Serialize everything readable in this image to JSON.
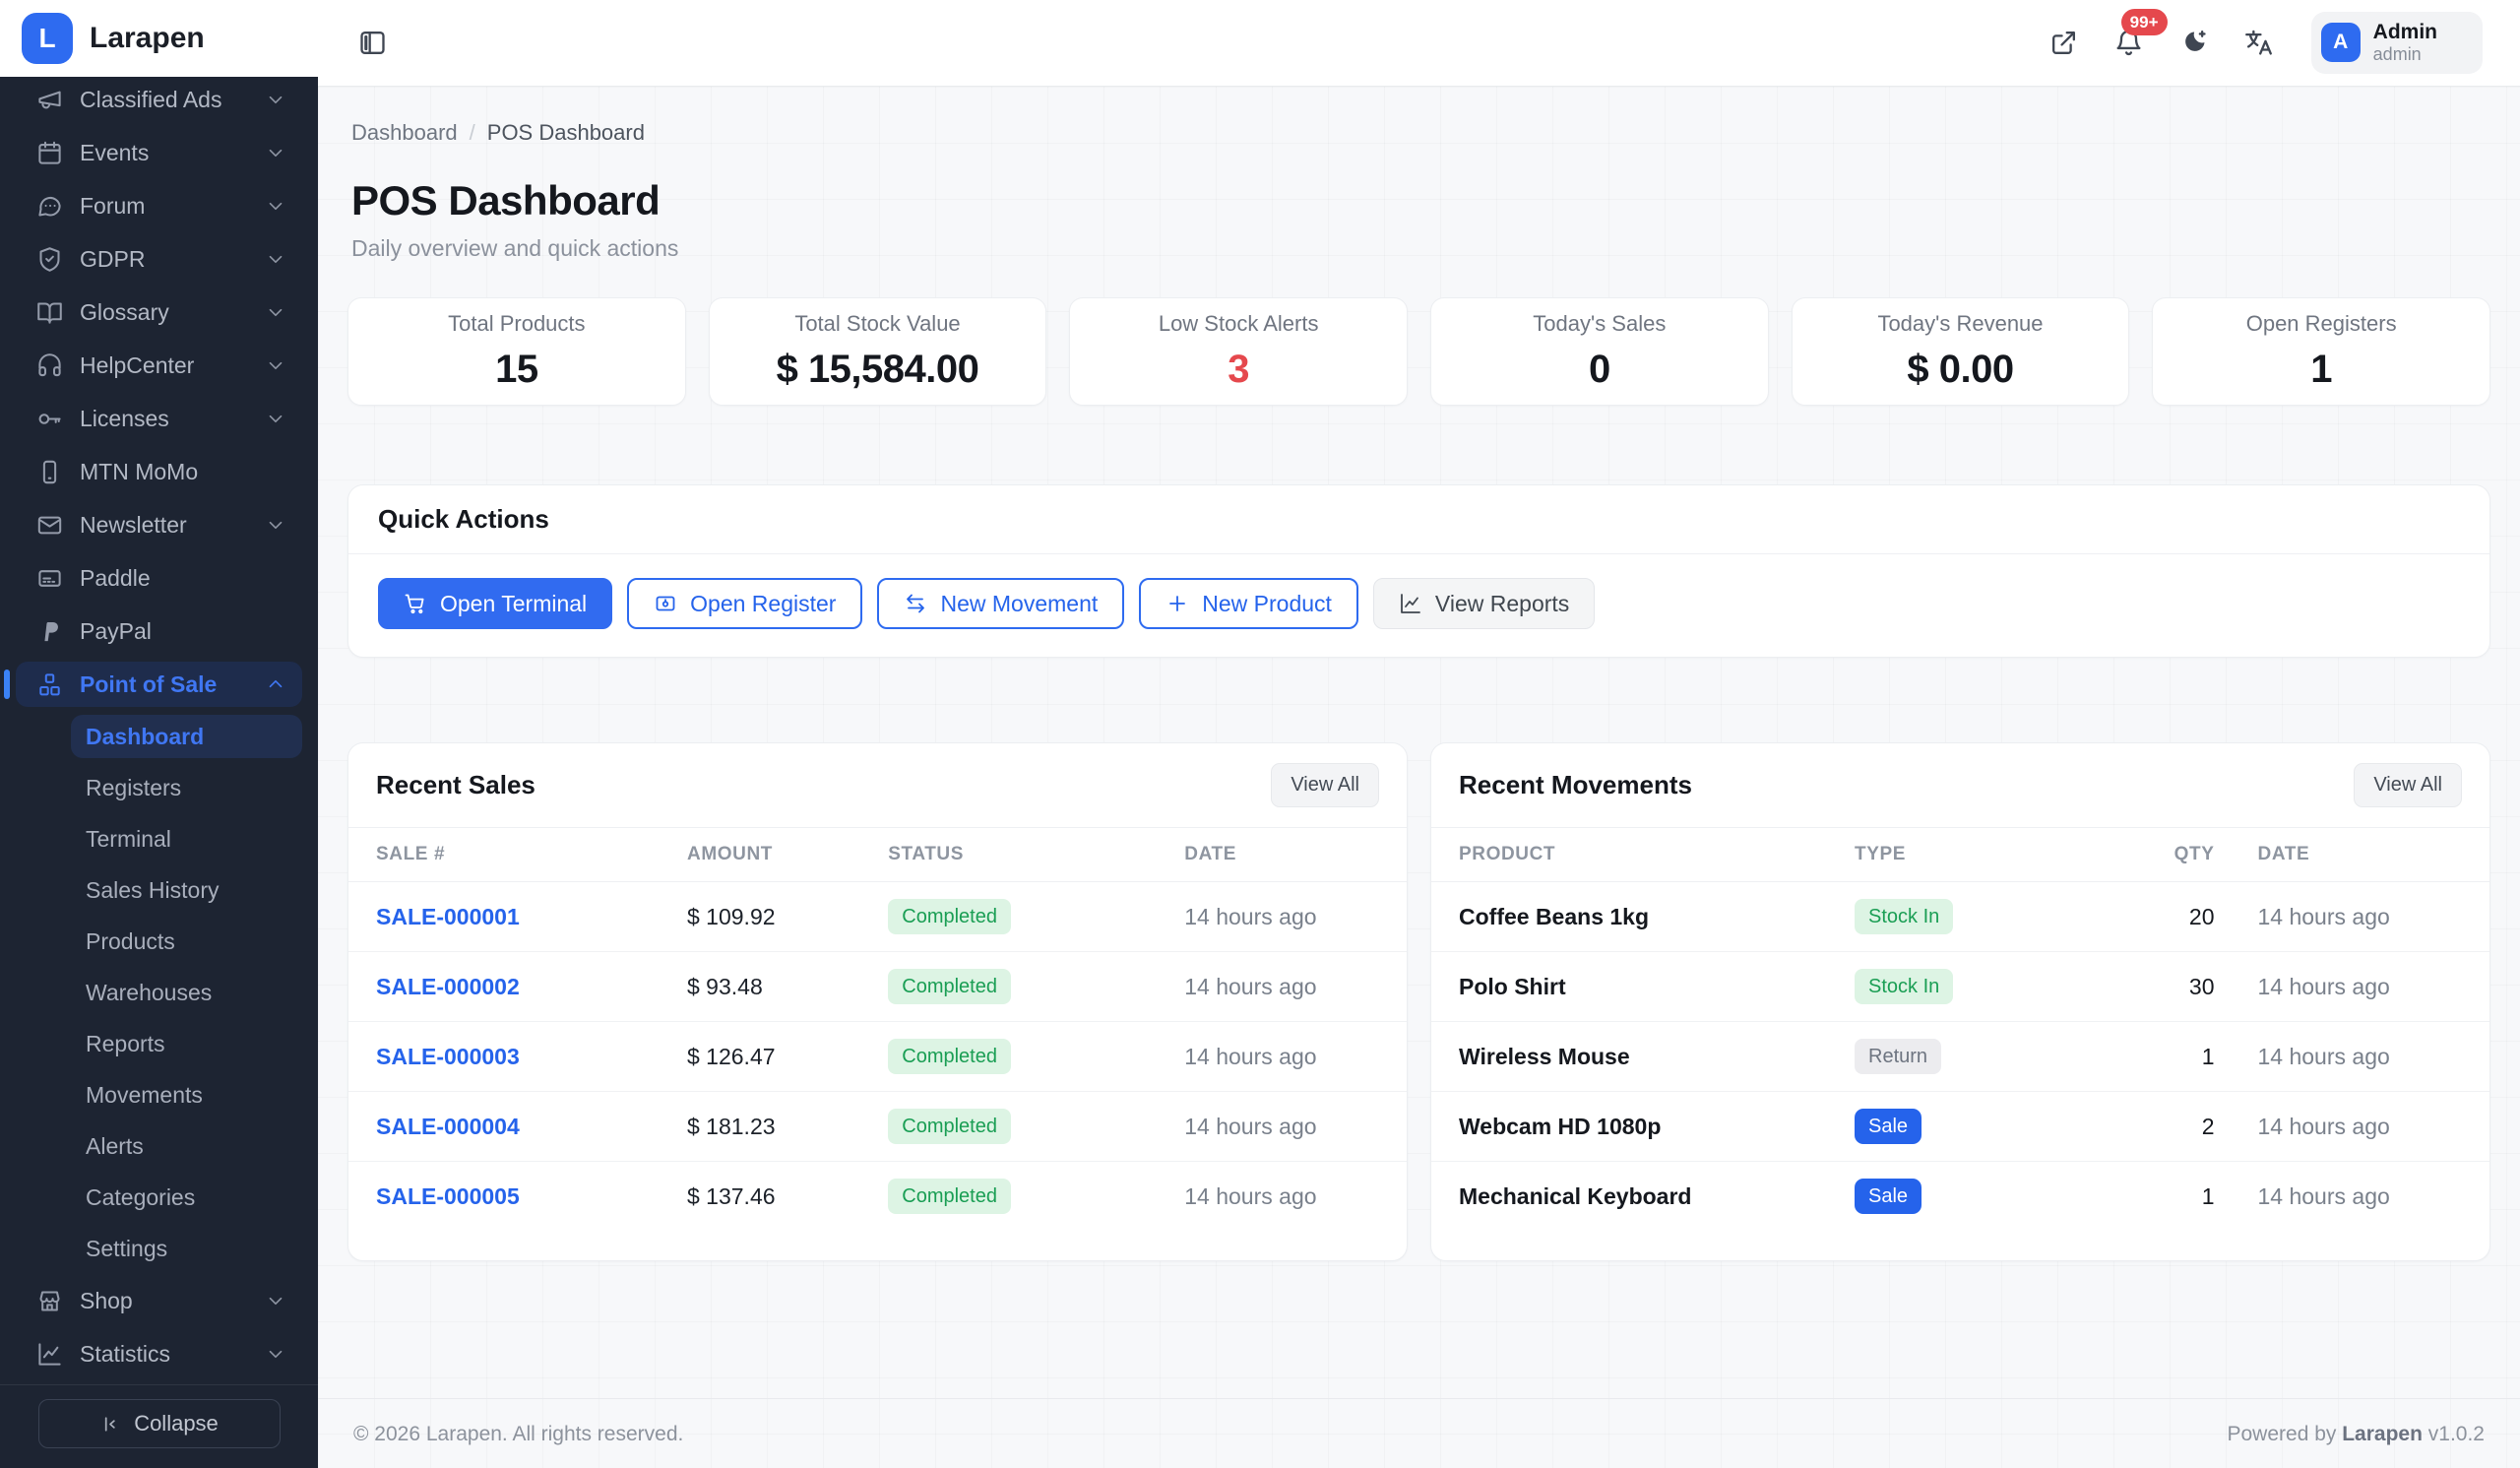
{
  "brand": {
    "name": "Larapen",
    "logo_letter": "L"
  },
  "colors": {
    "accent": "#2e6bf0",
    "sidebar_bg": "#1d2432",
    "danger": "#e5484d",
    "success_bg": "#ddf4e4",
    "success_text": "#1a9e54"
  },
  "sidebar": {
    "items": [
      {
        "label": "Classified Ads",
        "icon": "megaphone",
        "chevron": true
      },
      {
        "label": "Events",
        "icon": "calendar",
        "chevron": true
      },
      {
        "label": "Forum",
        "icon": "chat",
        "chevron": true
      },
      {
        "label": "GDPR",
        "icon": "shield",
        "chevron": true
      },
      {
        "label": "Glossary",
        "icon": "book",
        "chevron": true
      },
      {
        "label": "HelpCenter",
        "icon": "headset",
        "chevron": true
      },
      {
        "label": "Licenses",
        "icon": "key",
        "chevron": true
      },
      {
        "label": "MTN MoMo",
        "icon": "phone",
        "chevron": false
      },
      {
        "label": "Newsletter",
        "icon": "mail",
        "chevron": true
      },
      {
        "label": "Paddle",
        "icon": "receipt",
        "chevron": false
      },
      {
        "label": "PayPal",
        "icon": "paypal",
        "chevron": false
      },
      {
        "label": "Point of Sale",
        "icon": "cubes",
        "chevron": true,
        "expanded": true,
        "active": true,
        "children": [
          {
            "label": "Dashboard",
            "active": true
          },
          {
            "label": "Registers"
          },
          {
            "label": "Terminal"
          },
          {
            "label": "Sales History"
          },
          {
            "label": "Products"
          },
          {
            "label": "Warehouses"
          },
          {
            "label": "Reports"
          },
          {
            "label": "Movements"
          },
          {
            "label": "Alerts"
          },
          {
            "label": "Categories"
          },
          {
            "label": "Settings"
          }
        ]
      },
      {
        "label": "Shop",
        "icon": "shop",
        "chevron": true
      },
      {
        "label": "Statistics",
        "icon": "chart-line",
        "chevron": true
      }
    ],
    "collapse_label": "Collapse"
  },
  "header": {
    "notification_badge": "99+",
    "user": {
      "name": "Admin",
      "role": "admin",
      "avatar_letter": "A"
    }
  },
  "breadcrumb": {
    "items": [
      "Dashboard",
      "POS Dashboard"
    ],
    "separator": "/"
  },
  "page": {
    "title": "POS Dashboard",
    "subtitle": "Daily overview and quick actions"
  },
  "stats": [
    {
      "label": "Total Products",
      "value": "15"
    },
    {
      "label": "Total Stock Value",
      "value": "$ 15,584.00"
    },
    {
      "label": "Low Stock Alerts",
      "value": "3",
      "color": "red"
    },
    {
      "label": "Today's Sales",
      "value": "0"
    },
    {
      "label": "Today's Revenue",
      "value": "$ 0.00"
    },
    {
      "label": "Open Registers",
      "value": "1"
    }
  ],
  "quick_actions": {
    "title": "Quick Actions",
    "buttons": [
      {
        "label": "Open Terminal",
        "icon": "cart",
        "variant": "primary"
      },
      {
        "label": "Open Register",
        "icon": "register",
        "variant": "outline"
      },
      {
        "label": "New Movement",
        "icon": "swap",
        "variant": "outline"
      },
      {
        "label": "New Product",
        "icon": "plus",
        "variant": "outline"
      },
      {
        "label": "View Reports",
        "icon": "chart",
        "variant": "neutral"
      }
    ]
  },
  "recent_sales": {
    "title": "Recent Sales",
    "view_all": "View All",
    "columns": [
      "SALE #",
      "AMOUNT",
      "STATUS",
      "DATE"
    ],
    "rows": [
      {
        "sale": "SALE-000001",
        "amount": "$ 109.92",
        "status": "Completed",
        "date": "14 hours ago"
      },
      {
        "sale": "SALE-000002",
        "amount": "$ 93.48",
        "status": "Completed",
        "date": "14 hours ago"
      },
      {
        "sale": "SALE-000003",
        "amount": "$ 126.47",
        "status": "Completed",
        "date": "14 hours ago"
      },
      {
        "sale": "SALE-000004",
        "amount": "$ 181.23",
        "status": "Completed",
        "date": "14 hours ago"
      },
      {
        "sale": "SALE-000005",
        "amount": "$ 137.46",
        "status": "Completed",
        "date": "14 hours ago"
      }
    ]
  },
  "recent_movements": {
    "title": "Recent Movements",
    "view_all": "View All",
    "columns": [
      "PRODUCT",
      "TYPE",
      "QTY",
      "DATE"
    ],
    "rows": [
      {
        "product": "Coffee Beans 1kg",
        "type": "Stock In",
        "type_variant": "green",
        "qty": "20",
        "date": "14 hours ago"
      },
      {
        "product": "Polo Shirt",
        "type": "Stock In",
        "type_variant": "green",
        "qty": "30",
        "date": "14 hours ago"
      },
      {
        "product": "Wireless Mouse",
        "type": "Return",
        "type_variant": "gray",
        "qty": "1",
        "date": "14 hours ago"
      },
      {
        "product": "Webcam HD 1080p",
        "type": "Sale",
        "type_variant": "blue",
        "qty": "2",
        "date": "14 hours ago"
      },
      {
        "product": "Mechanical Keyboard",
        "type": "Sale",
        "type_variant": "blue",
        "qty": "1",
        "date": "14 hours ago"
      }
    ]
  },
  "footer": {
    "left": "© 2026 Larapen. All rights reserved.",
    "powered_prefix": "Powered by",
    "brand": "Larapen",
    "version": "v1.0.2"
  }
}
